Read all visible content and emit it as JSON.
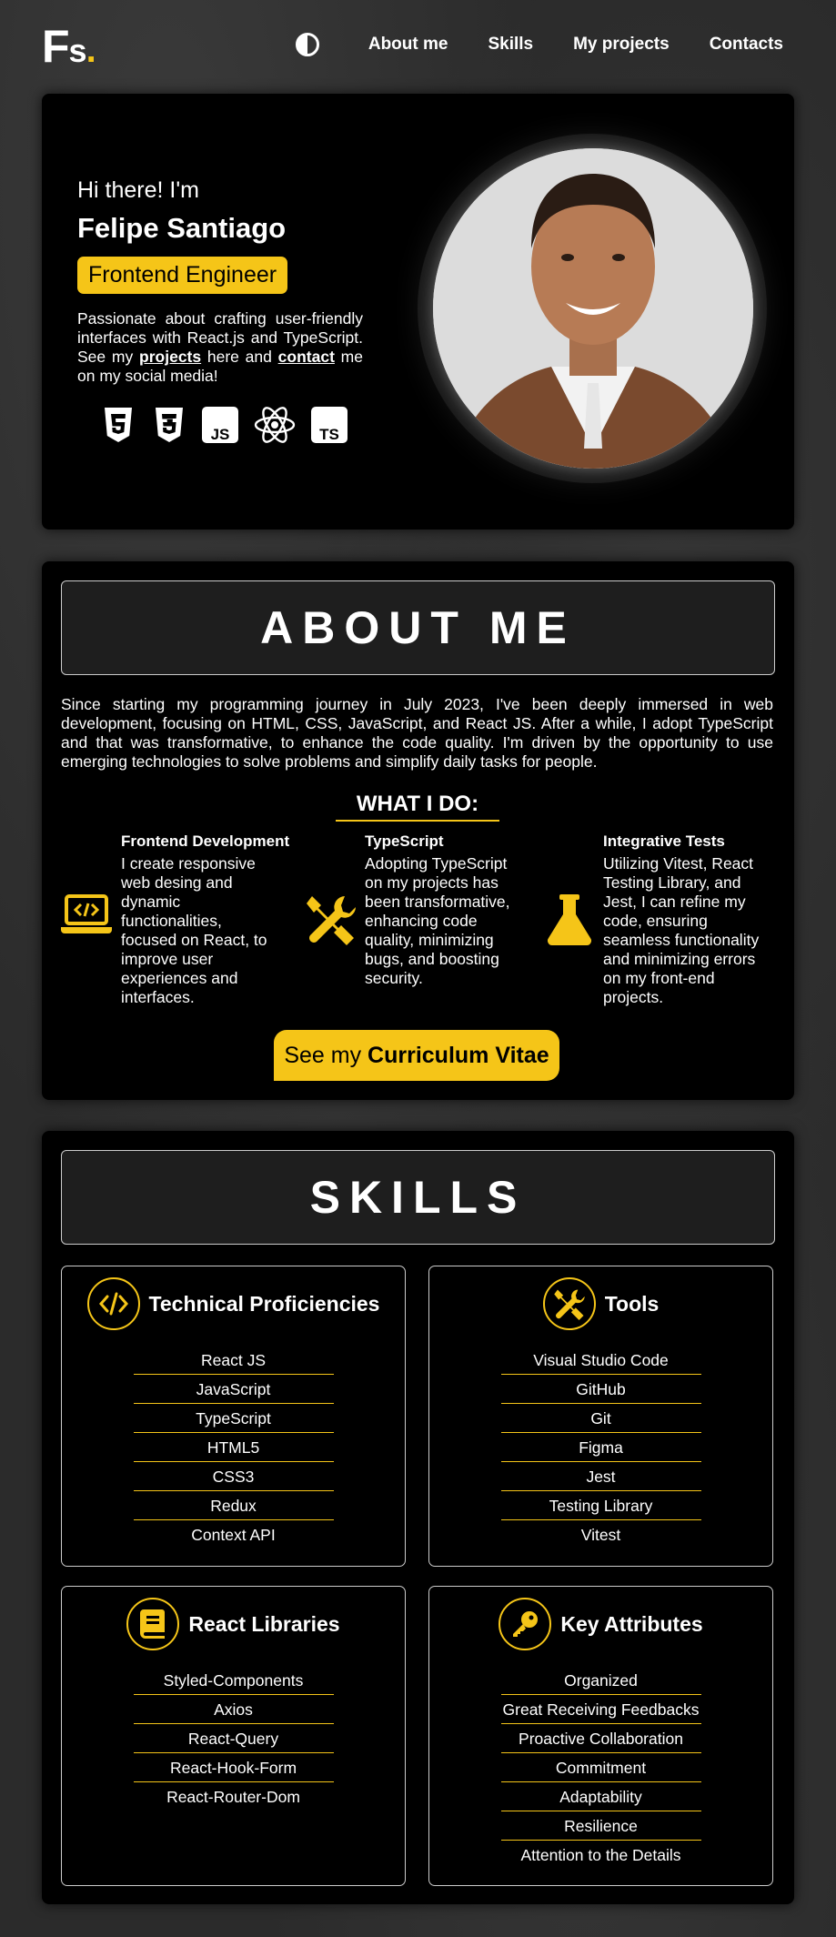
{
  "header": {
    "logo": {
      "letter_f": "F",
      "letter_s": "s",
      "dot": "."
    },
    "nav": [
      "About me",
      "Skills",
      "My projects",
      "Contacts"
    ],
    "theme_icon": "contrast-icon"
  },
  "hero": {
    "greeting": "Hi there! I'm",
    "name": "Felipe Santiago",
    "role": "Frontend Engineer",
    "intro_1": "Passionate about crafting user-friendly interfaces with React.js and TypeScript. See my ",
    "projects_link": "projects",
    "intro_2": " here and ",
    "contact_link": "contact",
    "intro_3": " me on my social media!",
    "tech_icons": [
      "html5-icon",
      "css3-icon",
      "js-icon",
      "react-icon",
      "ts-icon"
    ],
    "tech_labels": {
      "js": "JS",
      "ts": "TS"
    }
  },
  "about": {
    "title": "ABOUT ME",
    "text": "Since starting my programming journey in July 2023, I've been deeply immersed in web development, focusing on HTML, CSS, JavaScript, and React JS. After a while, I adopt TypeScript and that was transformative, to enhance the code quality. I'm driven by the opportunity to use emerging technologies to solve problems and simplify daily tasks for people.",
    "what_i_do": "WHAT I DO:",
    "services": [
      {
        "title": "Frontend Development",
        "desc": "I create responsive web desing and dynamic functionalities, focused on React, to improve user experiences and interfaces.",
        "icon": "laptop-code-icon"
      },
      {
        "title": "TypeScript",
        "desc": "Adopting TypeScript on my projects has been transformative, enhancing code quality, minimizing bugs, and boosting security.",
        "icon": "tools-icon"
      },
      {
        "title": "Integrative Tests",
        "desc": "Utilizing Vitest, React Testing Library, and Jest, I can refine my code, ensuring seamless functionality and minimizing errors on my front-end projects.",
        "icon": "flask-icon"
      }
    ],
    "cv_prefix": "See my ",
    "cv_bold": "Curriculum Vitae"
  },
  "skills": {
    "title": "SKILLS",
    "panels": [
      {
        "title": "Technical Proficiencies",
        "icon": "code-icon",
        "items": [
          "React JS",
          "JavaScript",
          "TypeScript",
          "HTML5",
          "CSS3",
          "Redux",
          "Context API"
        ]
      },
      {
        "title": "Tools",
        "icon": "tools-icon",
        "items": [
          "Visual Studio Code",
          "GitHub",
          "Git",
          "Figma",
          "Jest",
          "Testing Library",
          "Vitest"
        ]
      },
      {
        "title": "React Libraries",
        "icon": "book-icon",
        "items": [
          "Styled-Components",
          "Axios",
          "React-Query",
          "React-Hook-Form",
          "React-Router-Dom"
        ]
      },
      {
        "title": "Key Attributes",
        "icon": "key-icon",
        "items": [
          "Organized",
          "Great Receiving Feedbacks",
          "Proactive Collaboration",
          "Commitment",
          "Adaptability",
          "Resilience",
          "Attention to the Details"
        ]
      }
    ]
  },
  "colors": {
    "accent": "#f5c518",
    "card": "#000000",
    "background": "#2b2b2b"
  }
}
